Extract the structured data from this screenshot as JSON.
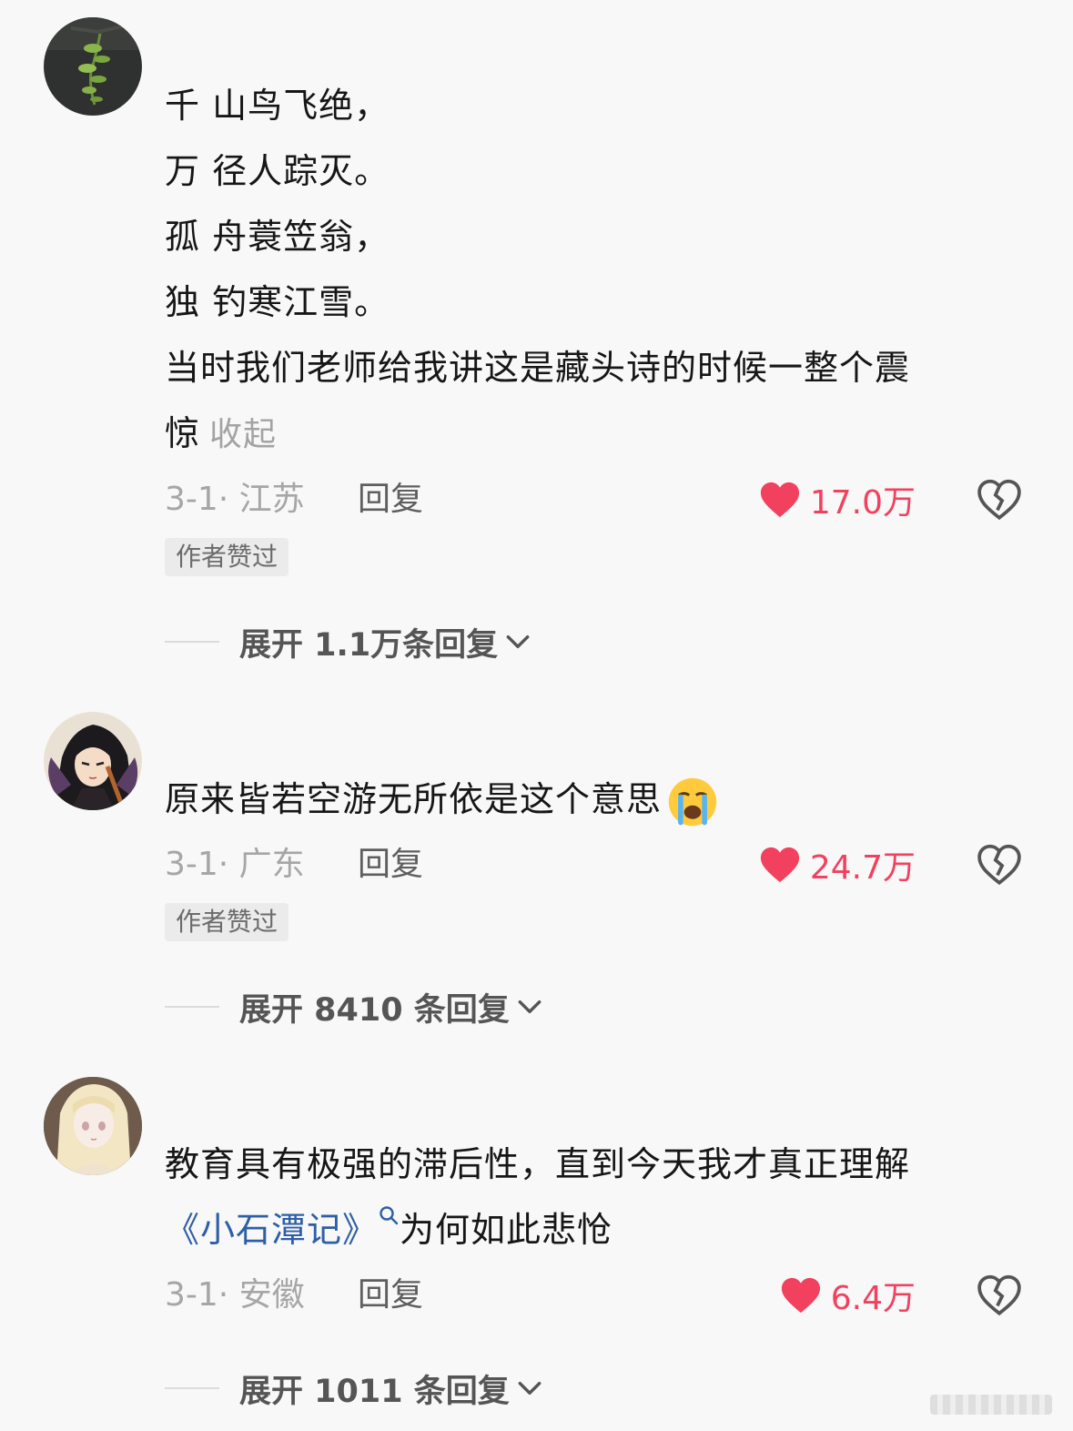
{
  "comments": [
    {
      "lines": [
        "千 山鸟飞绝，",
        "万 径人踪灭。",
        "孤 舟蓑笠翁，",
        "独 钓寒江雪。",
        "当时我们老师给我讲这是藏头诗的时候一整个震"
      ],
      "last_line": "惊",
      "collapse": "收起",
      "date_location": "3-1· 江苏",
      "reply": "回复",
      "likes": "17.0万",
      "badge": "作者赞过",
      "expand": "展开 1.1万条回复"
    },
    {
      "text": "原来皆若空游无所依是这个意思",
      "date_location": "3-1· 广东",
      "reply": "回复",
      "likes": "24.7万",
      "badge": "作者赞过",
      "expand": "展开 8410 条回复"
    },
    {
      "line1": "教育具有极强的滞后性，直到今天我才真正理解",
      "link": "《小石潭记》",
      "line2_rest": "为何如此悲怆",
      "date_location": "3-1· 安徽",
      "reply": "回复",
      "likes": "6.4万",
      "expand": "展开 1011 条回复"
    }
  ],
  "colors": {
    "like": "#f2415f",
    "link": "#2e5fa6",
    "muted": "#a6a6a6"
  },
  "icons": [
    "heart-icon",
    "broken-heart-icon",
    "chevron-down-icon",
    "search-icon",
    "crying-emoji-icon"
  ]
}
